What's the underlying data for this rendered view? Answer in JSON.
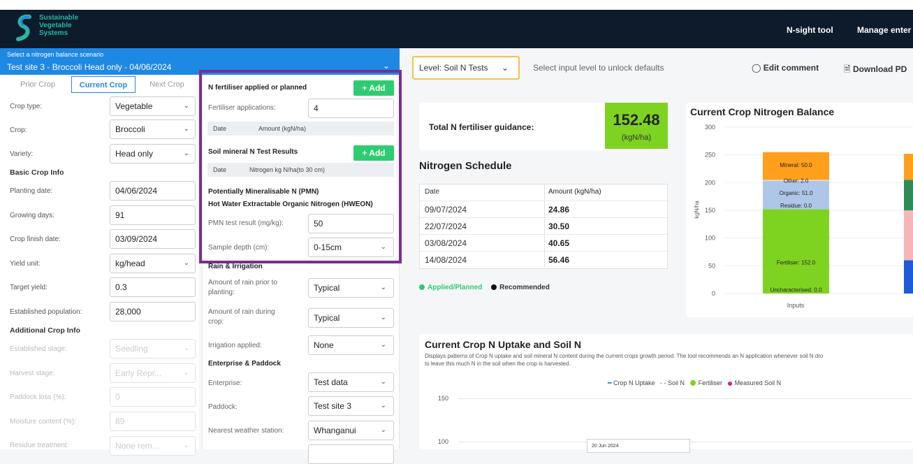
{
  "brand": {
    "line1": "Sustainable",
    "line2": "Vegetable",
    "line3": "Systems"
  },
  "nav": {
    "item1": "N-sight tool",
    "item2": "Manage enter"
  },
  "scenario": {
    "label": "Select a nitrogen balance scenario",
    "value": "Test site 3 - Broccoli Head only - 04/06/2024"
  },
  "tabs": {
    "prev": "Prior Crop",
    "current": "Current Crop",
    "next": "Next Crop"
  },
  "left": {
    "crop_type_label": "Crop type:",
    "crop_type": "Vegetable",
    "crop_label": "Crop:",
    "crop": "Broccoli",
    "variety_label": "Variety:",
    "variety": "Head only",
    "basic_info": "Basic Crop Info",
    "planting_label": "Planting date:",
    "planting": "04/06/2024",
    "growing_label": "Growing days:",
    "growing": "91",
    "finish_label": "Crop finish date:",
    "finish": "03/09/2024",
    "yield_unit_label": "Yield unit:",
    "yield_unit": "kg/head",
    "target_label": "Target yield:",
    "target": "0.3",
    "population_label": "Established population:",
    "population": "28,000",
    "additional_info": "Additional Crop Info",
    "stage_label": "Established stage:",
    "stage": "Seedling",
    "harvest_label": "Harvest stage:",
    "harvest": "Early Repr...",
    "paddock_loss_label": "Paddock loss (%):",
    "paddock_loss": "0",
    "moisture_label": "Moisture content (%):",
    "moisture": "89",
    "residue_label": "Residue treatment:",
    "residue": "None rem..."
  },
  "mid": {
    "n_fert_head": "N fertiliser applied or planned",
    "add": "Add",
    "fert_apps_label": "Fertiliser applications:",
    "fert_apps": "4",
    "col_date": "Date",
    "col_amount": "Amount (kgN/ha)",
    "soil_head": "Soil mineral N Test Results",
    "col_nitrogen": "Nitrogen kg N/ha(to 30 cm)",
    "pmn_head": "Potentially Mineralisable N (PMN)",
    "hweon_head": "Hot Water Extractable Organic Nitrogen (HWEON)",
    "pmn_label": "PMN test result (mg/kg):",
    "pmn": "50",
    "depth_label": "Sample depth (cm):",
    "depth": "0-15cm",
    "rain_head": "Rain & Irrigation",
    "rain_prior_label": "Amount of rain prior to planting:",
    "rain_prior": "Typical",
    "rain_during_label": "Amount of rain during crop:",
    "rain_during": "Typical",
    "irrigation_label": "Irrigation applied:",
    "irrigation": "None",
    "enterprise_head": "Enterprise & Paddock",
    "enterprise_label": "Enterprise:",
    "enterprise": "Test data",
    "paddock_label": "Paddock:",
    "paddock": "Test site 3",
    "weather_label": "Nearest weather station:",
    "weather": "Whanganui"
  },
  "toolbar": {
    "level": "Level: Soil N Tests",
    "hint": "Select input level to unlock defaults",
    "edit": "Edit comment",
    "download": "Download PD"
  },
  "guidance": {
    "label": "Total N fertiliser guidance:",
    "value": "152.48",
    "unit": "(kgN/ha)"
  },
  "schedule": {
    "title": "Nitrogen Schedule",
    "col_date": "Date",
    "col_amount": "Amount (kgN/ha)",
    "rows": [
      {
        "date": "09/07/2024",
        "amount": "24.86"
      },
      {
        "date": "22/07/2024",
        "amount": "30.50"
      },
      {
        "date": "03/08/2024",
        "amount": "40.65"
      },
      {
        "date": "14/08/2024",
        "amount": "56.46"
      }
    ],
    "legend_applied": "Applied/Planned",
    "legend_recommended": "Recommended"
  },
  "colors": {
    "green": "#2ecc71",
    "blue": "#1e88e5",
    "purple": "#7b2d91",
    "navy": "#0d1b2a"
  },
  "chart_data": [
    {
      "type": "bar",
      "title": "Current Crop Nitrogen Balance",
      "ylabel": "kgN/ha",
      "xlabel": "Inputs",
      "ylim": [
        0,
        300
      ],
      "yticks": [
        0,
        50,
        100,
        150,
        200,
        250,
        300
      ],
      "categories": [
        "Inputs"
      ],
      "series": [
        {
          "name": "Uncharacterised",
          "label": "Uncharacterised: 0.0",
          "values": [
            0
          ],
          "color": "#7ed321"
        },
        {
          "name": "Fertiliser",
          "label": "Fertiliser: 152.0",
          "values": [
            152
          ],
          "color": "#7ed321"
        },
        {
          "name": "Residue",
          "label": "Residue: 0.0",
          "values": [
            0
          ],
          "color": "#aec7e8"
        },
        {
          "name": "Organic",
          "label": "Organic: 51.0",
          "values": [
            51
          ],
          "color": "#aec7e8"
        },
        {
          "name": "Other",
          "label": "Other: 2.0",
          "values": [
            2
          ],
          "color": "#e0e0e0"
        },
        {
          "name": "Mineral",
          "label": "Mineral: 50.0",
          "values": [
            50
          ],
          "color": "#ff9f1c"
        }
      ]
    },
    {
      "type": "line",
      "title": "Current Crop N Uptake and Soil N",
      "description": "Displays patterns of Crop N uptake and soil mineral N content during the current crops growth period. The tool recommends an N application whenever soil N dro",
      "description2": "to leave this much N in the soil when the crop is harvested.",
      "legend": [
        "Crop N Uptake",
        "Soil N",
        "Fertiliser",
        "Measured Soil N"
      ],
      "yticks": [
        100,
        150
      ],
      "tooltip": "20 Jun 2024"
    }
  ]
}
